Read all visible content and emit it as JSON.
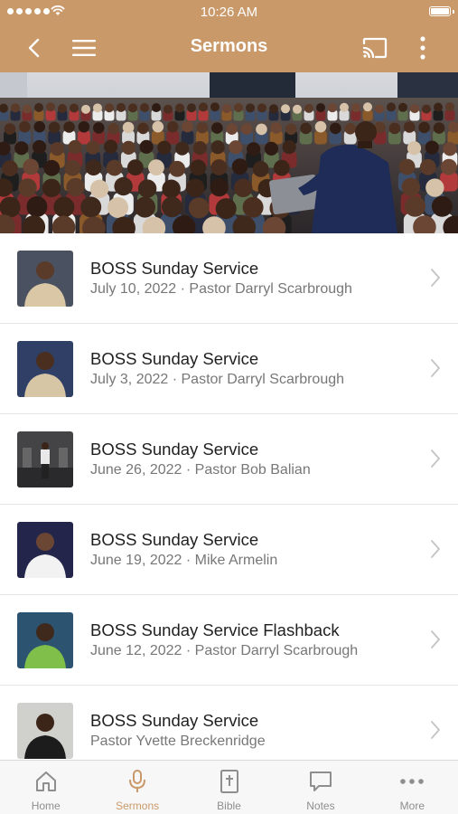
{
  "colors": {
    "accent": "#c9996a",
    "tab_inactive": "#8e8e8e",
    "title_text": "#1f1f1f",
    "subtitle_text": "#777777"
  },
  "status_bar": {
    "time": "10:26 AM",
    "signal_icon": "signal-dots-icon",
    "wifi_icon": "wifi-icon",
    "battery_icon": "battery-icon",
    "battery_level": 1.0
  },
  "header": {
    "title": "Sermons",
    "back_icon": "chevron-left-icon",
    "menu_icon": "hamburger-menu-icon",
    "cast_icon": "cast-icon",
    "more_icon": "vertical-ellipsis-icon"
  },
  "hero": {
    "image": "congregation-photo"
  },
  "sermons": [
    {
      "title": "BOSS Sunday Service",
      "subtitle": "July 10, 2022 · Pastor Darryl Scarbrough"
    },
    {
      "title": "BOSS Sunday Service",
      "subtitle": "July 3, 2022 · Pastor Darryl Scarbrough"
    },
    {
      "title": "BOSS Sunday Service",
      "subtitle": "June 26, 2022 · Pastor Bob Balian"
    },
    {
      "title": "BOSS Sunday Service",
      "subtitle": "June 19, 2022 · Mike Armelin"
    },
    {
      "title": "BOSS Sunday Service Flashback",
      "subtitle": "June 12, 2022 · Pastor Darryl Scarbrough"
    },
    {
      "title": "BOSS Sunday Service",
      "subtitle": "Pastor Yvette Breckenridge"
    }
  ],
  "tabbar": {
    "active": "Sermons",
    "items": [
      {
        "label": "Home",
        "icon": "home-icon"
      },
      {
        "label": "Sermons",
        "icon": "microphone-icon"
      },
      {
        "label": "Bible",
        "icon": "bible-icon"
      },
      {
        "label": "Notes",
        "icon": "speech-bubble-icon"
      },
      {
        "label": "More",
        "icon": "more-dots-icon"
      }
    ]
  }
}
